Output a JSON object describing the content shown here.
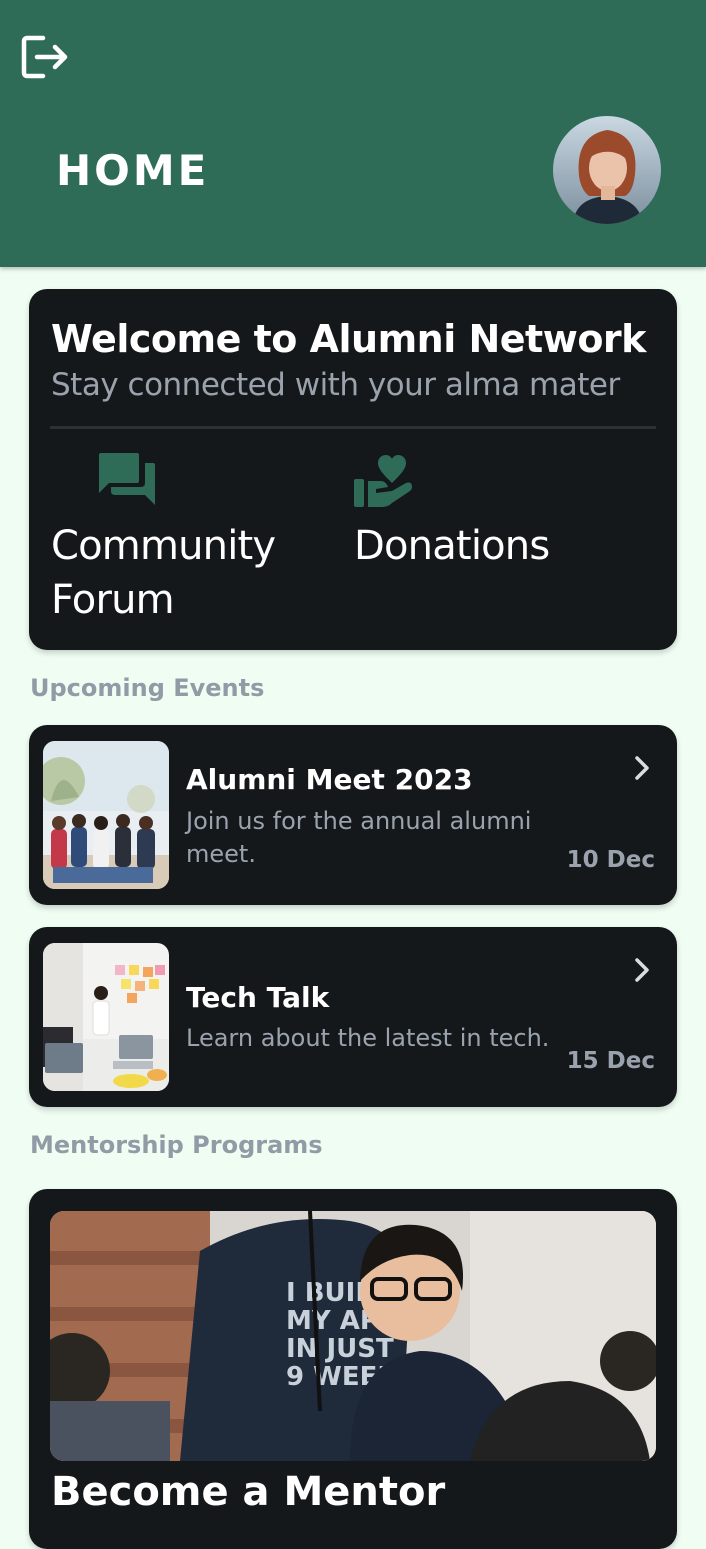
{
  "header": {
    "title": "HOME",
    "logout_icon": "logout-icon",
    "avatar": "profile-avatar",
    "background": "#2F6C58"
  },
  "welcome": {
    "title": "Welcome to Alumni Network",
    "subtitle": "Stay connected with your alma mater",
    "quick_links": [
      {
        "label": "Community\nForum",
        "icon": "forum-icon"
      },
      {
        "label": "Donations",
        "icon": "donation-hand-heart-icon"
      }
    ]
  },
  "events": {
    "section_title": "Upcoming Events",
    "items": [
      {
        "title": "Alumni Meet 2023",
        "description": "Join us for the annual alumni meet.",
        "date": "10 Dec"
      },
      {
        "title": "Tech Talk",
        "description": "Learn about the latest in tech.",
        "date": "15 Dec"
      }
    ]
  },
  "mentorship": {
    "section_title": "Mentorship Programs",
    "card_title": "Become a Mentor"
  },
  "colors": {
    "accent": "#2F6C58",
    "background": "#EFFDF3",
    "card": "#15181B",
    "muted_text": "#9AA3AD"
  }
}
